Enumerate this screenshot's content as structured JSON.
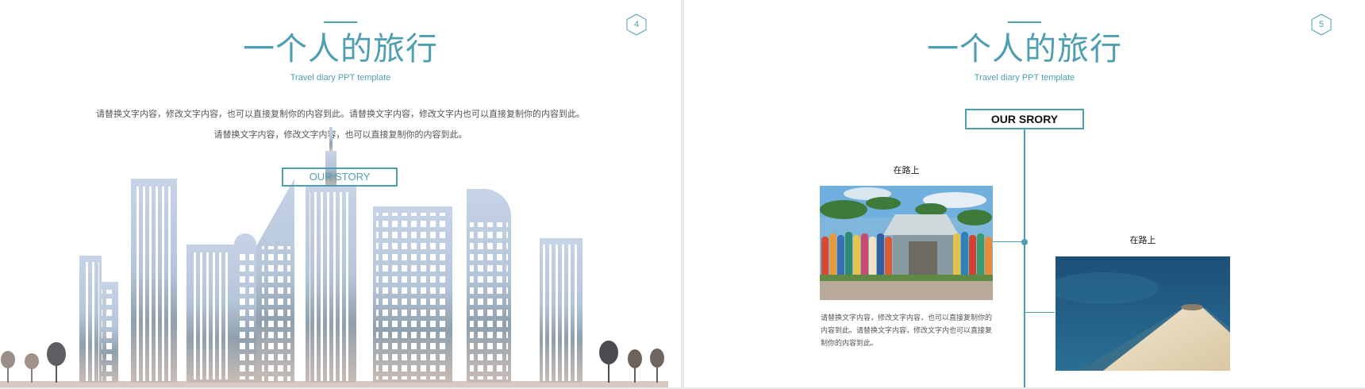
{
  "slide4": {
    "page_number": "4",
    "title": "一个人的旅行",
    "subtitle": "Travel diary PPT template",
    "body_line1": "请替换文字内容，修改文字内容，也可以直接复制你的内容到此。请替换文字内容，修改文字内也可以直接复制你的内容到此。",
    "body_line2": "请替换文字内容，修改文字内容，也可以直接复制你的内容到此。",
    "button_label": "OUR STORY"
  },
  "slide5": {
    "page_number": "5",
    "title": "一个人的旅行",
    "subtitle": "Travel diary PPT template",
    "story_label": "OUR SRORY",
    "items": [
      {
        "label": "在路上",
        "description": "请替换文字内容，修改文字内容，也可以直接复制你的内容到此。请替换文字内容，修改文字内也可以直接复制你的内容到此。"
      },
      {
        "label": "在路上"
      }
    ]
  },
  "colors": {
    "accent": "#4e9fb1",
    "skyline_blue": "#a9bfd6",
    "text_gray": "#555555"
  }
}
